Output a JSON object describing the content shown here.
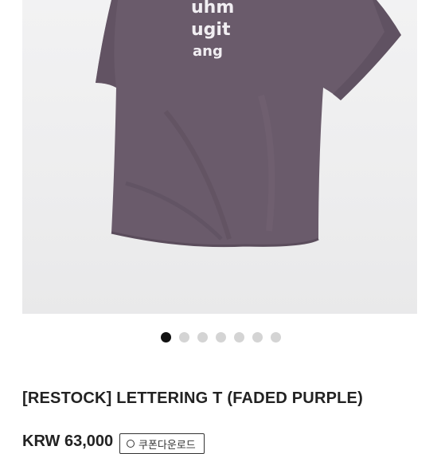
{
  "product": {
    "image_alt": "Faded purple t-shirt with white lettering print",
    "shirt_print_lines": [
      "uhm",
      "ugit",
      "ang"
    ],
    "title": "[RESTOCK] LETTERING T (FADED PURPLE)",
    "price": "KRW 63,000",
    "coupon_label": "쿠폰다운로드"
  },
  "carousel": {
    "total": 7,
    "active_index": 0
  },
  "colors": {
    "shirt": "#6a5b6b",
    "background": "#ededee",
    "active_dot": "#111111",
    "inactive_dot": "#d4d4d4"
  }
}
